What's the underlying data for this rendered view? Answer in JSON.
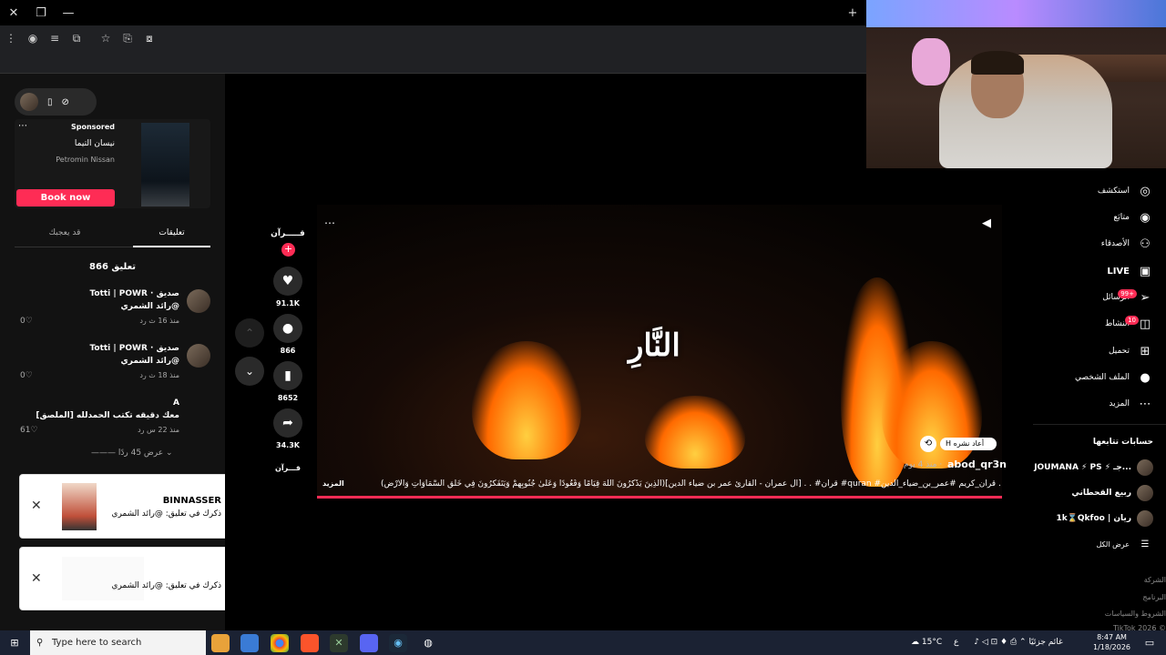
{
  "browser": {
    "close": "✕",
    "restore": "❐",
    "minimize": "—",
    "newtab": "+",
    "toolbar_icons": [
      "⋮",
      "◉",
      "≡",
      "⧉",
      "☆",
      "⎘",
      "⧇"
    ]
  },
  "left": {
    "ad": {
      "sponsored": "Sponsored",
      "name": "نيسان التيما",
      "sub": "Petromin Nissan",
      "cta": "Book now",
      "dots": "⋯"
    },
    "tabs": [
      "تعليقات",
      "قد يعجبك"
    ],
    "comment_count": "866 تعليق",
    "comments": [
      {
        "author": "Totti | POWR · صديق",
        "text": "رائد الشمري@",
        "meta": "منذ 16 ث     رد",
        "likes": "0♡"
      },
      {
        "author": "Totti | POWR · صديق",
        "text": "رائد الشمري@",
        "meta": "منذ 18 ث     رد",
        "likes": "0♡"
      },
      {
        "author": "A",
        "text": "معك دقيقه تكتب الحمدلله [الملصق]",
        "meta": "منذ 22 س     رد",
        "likes": "61♡"
      }
    ],
    "more_replies": "——— عرض 45 ردًا ⌄",
    "notifications": [
      {
        "name": "BINNASSER",
        "msg": "ذكرك في تعليق: @رائد الشمري",
        "close": "✕"
      },
      {
        "name": "",
        "msg": "ذكرك في تعليق: @رائد الشمري",
        "close": "✕"
      }
    ]
  },
  "video": {
    "title": "النَّارِ",
    "dots": "⋯",
    "sound": "◀",
    "author": "abod_qr3n",
    "ago": "منذ 4 يوم ·",
    "repost": "H أعاد نشره",
    "caption": "(الَّذِينَ يَذْكُرُونَ اللَّهَ قِيَامًا وَقُعُودًا وَعَلَىٰ جُنُوبِهِمْ وَيَتَفَكَّرُونَ فِي خَلْقِ السَّمَاوَاتِ وَالْأَرْضِ)[آل عمران - القارئ عمر بن ضياء الدين] . . #قرآن #quran #قرآن_كريم #عمر_بن_ضياء_الدين ...",
    "more": "المزيد"
  },
  "actions": {
    "creator": "قـــــرآن",
    "like_icon": "♥",
    "likes": "91.1K",
    "comment_icon": "●",
    "comments": "866",
    "save_icon": "▮",
    "saves": "8652",
    "share_icon": "➦",
    "shares": "34.3K",
    "sound_label": "قـــرآن",
    "up": "⌃",
    "down": "⌄"
  },
  "right": {
    "nav": [
      {
        "label": "استكشف",
        "icon": "◎"
      },
      {
        "label": "متابَع",
        "icon": "◉"
      },
      {
        "label": "الأصدقاء",
        "icon": "⚇"
      },
      {
        "label": "LIVE",
        "icon": "▣"
      },
      {
        "label": "الرسائل",
        "icon": "➢"
      },
      {
        "label": "النشاط",
        "icon": "◫"
      },
      {
        "label": "تحميل",
        "icon": "⊞"
      },
      {
        "label": "الملف الشخصي",
        "icon": "●"
      },
      {
        "label": "المزيد",
        "icon": "⋯"
      }
    ],
    "badges": {
      "messages": "99+",
      "activity": "10"
    },
    "following_title": "حسابات تتابعها",
    "accounts": [
      "JOUMANA ⚡ PS ⚡ جـ...",
      "ربيع القحطاني",
      "1k⌛Qkfoo | ريان"
    ],
    "show_all": "عرض الكل",
    "footer": [
      "الشركة",
      "البرنامج",
      "الشروط والسياسات",
      "TikTok 2026 ©"
    ]
  },
  "taskbar": {
    "search": "Type here to search",
    "weather": "15°C  غائم جزئيًا",
    "lang": "ع",
    "time": "8:47 AM",
    "date": "1/18/2026"
  }
}
